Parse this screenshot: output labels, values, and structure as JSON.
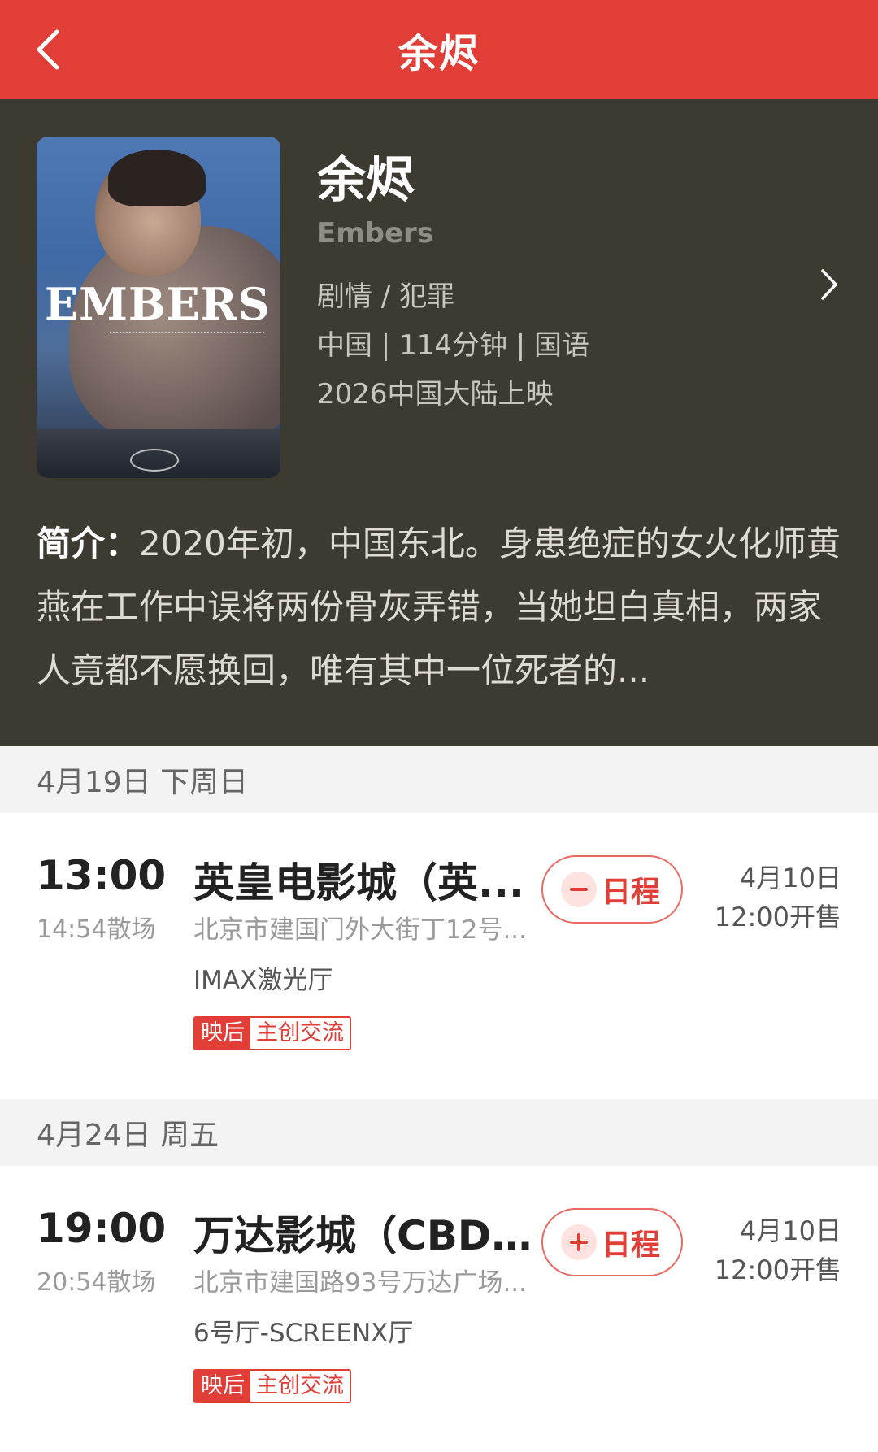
{
  "header": {
    "title": "余烬"
  },
  "movie": {
    "title": "余烬",
    "english_title": "Embers",
    "genre": "剧情 / 犯罪",
    "meta": "中国 | 114分钟 | 国语",
    "release": "2026中国大陆上映",
    "poster_text": "EMBERS",
    "synopsis_label": "简介：",
    "synopsis": "2020年初，中国东北。身患绝症的女火化师黄燕在工作中误将两份骨灰弄错，当她坦白真相，两家人竟都不愿换回，唯有其中一位死者的..."
  },
  "colors": {
    "accent": "#e03e37",
    "hero_bg": "#3d3a32"
  },
  "sessions": [
    {
      "date": "4月19日 下周日",
      "start": "13:00",
      "end": "14:54散场",
      "cinema": "英皇电影城（英...",
      "address": "北京市建国门外大街丁12号...",
      "hall": "IMAX激光厅",
      "tag_a": "映后",
      "tag_b": "主创交流",
      "schedule_label": "日程",
      "schedule_state": "added",
      "sale_date": "4月10日",
      "sale_time": "12:00开售"
    },
    {
      "date": "4月24日 周五",
      "start": "19:00",
      "end": "20:54散场",
      "cinema": "万达影城（CBD...",
      "address": "北京市建国路93号万达广场...",
      "hall": "6号厅-SCREENX厅",
      "tag_a": "映后",
      "tag_b": "主创交流",
      "schedule_label": "日程",
      "schedule_state": "not-added",
      "sale_date": "4月10日",
      "sale_time": "12:00开售"
    }
  ]
}
